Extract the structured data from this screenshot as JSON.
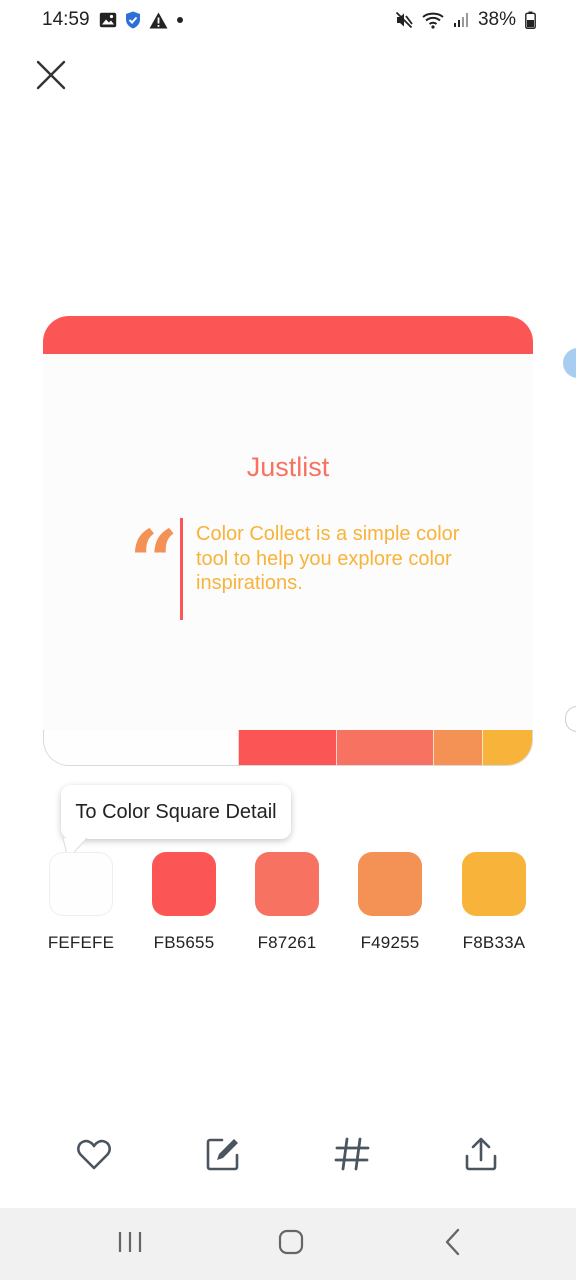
{
  "status_bar": {
    "time": "14:59",
    "battery": "38%"
  },
  "card": {
    "app_name": "Justlist",
    "quote_mark": "“",
    "quote": "Color Collect is a simple color tool to help you explore color inspirations.",
    "header_color": "#FB5655",
    "title_color": "#F87261",
    "quote_mark_color": "#F49255",
    "quote_bar_color": "#FB5655",
    "quote_text_color": "#F8B33A"
  },
  "tooltip": {
    "text": "To Color Square Detail"
  },
  "palette": [
    {
      "hex": "FEFEFE",
      "color": "#FEFEFE"
    },
    {
      "hex": "FB5655",
      "color": "#FB5655"
    },
    {
      "hex": "F87261",
      "color": "#F87261"
    },
    {
      "hex": "F49255",
      "color": "#F49255"
    },
    {
      "hex": "F8B33A",
      "color": "#F8B33A"
    }
  ],
  "toolbar": {
    "icons": [
      "heart-icon",
      "edit-icon",
      "hashtag-icon",
      "share-icon"
    ]
  },
  "icons": {
    "close": "close-icon",
    "nav": [
      "recent-apps-icon",
      "home-icon",
      "back-icon"
    ]
  }
}
